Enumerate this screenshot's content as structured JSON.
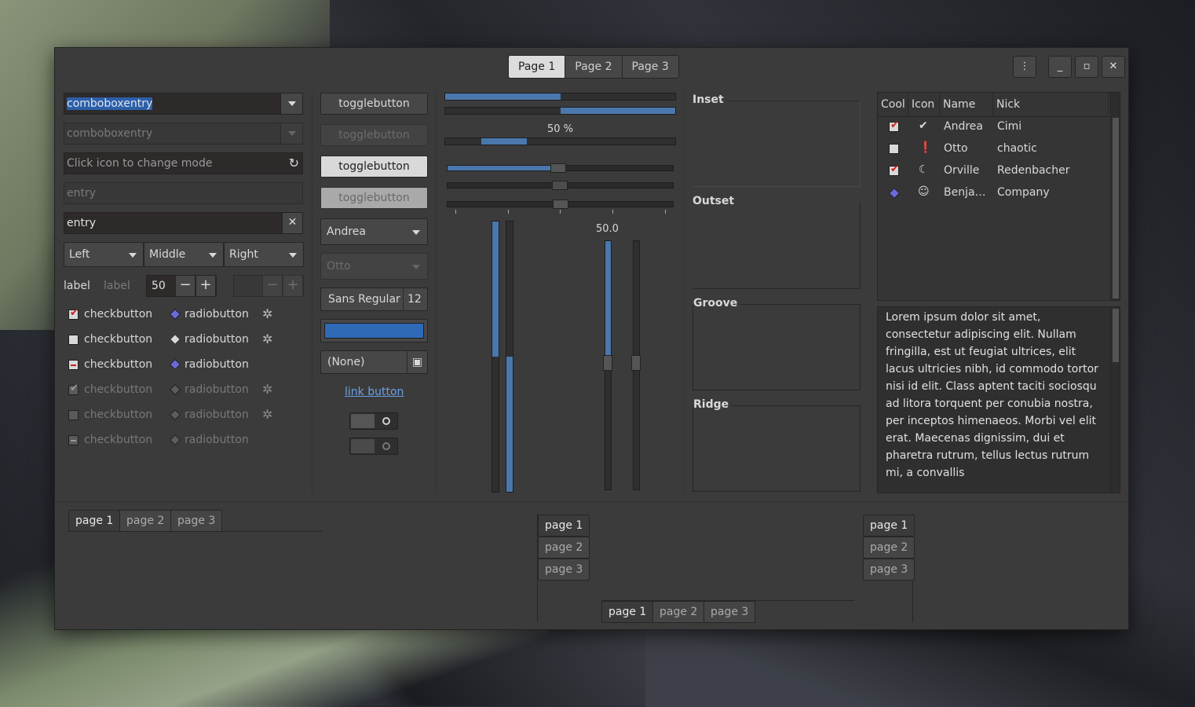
{
  "header": {
    "tabs": [
      "Page 1",
      "Page 2",
      "Page 3"
    ],
    "menu_icon": "vertical-dots-icon",
    "minimize_icon": "minimize-icon",
    "maximize_icon": "maximize-icon",
    "close_icon": "close-icon"
  },
  "entries": {
    "combo1": "comboboxentry",
    "combo2": "comboboxentry",
    "mode_placeholder": "Click icon to change mode",
    "entry_disabled": "entry",
    "entry_active": "entry"
  },
  "dropdowns": [
    "Left",
    "Middle",
    "Right"
  ],
  "labels": {
    "label1": "label",
    "label2": "label"
  },
  "spin": {
    "value": "50",
    "minus": "−",
    "plus": "+"
  },
  "checks": [
    {
      "label": "checkbutton",
      "state": "checked"
    },
    {
      "label": "checkbutton",
      "state": "unchecked"
    },
    {
      "label": "checkbutton",
      "state": "mixed"
    },
    {
      "label": "checkbutton",
      "state": "checked"
    },
    {
      "label": "checkbutton",
      "state": "unchecked"
    },
    {
      "label": "checkbutton",
      "state": "mixed"
    }
  ],
  "radios": [
    "radiobutton",
    "radiobutton",
    "radiobutton",
    "radiobutton",
    "radiobutton",
    "radiobutton"
  ],
  "toggles": [
    "togglebutton",
    "togglebutton",
    "togglebutton",
    "togglebutton"
  ],
  "combos": {
    "c1": "Andrea",
    "c2": "Otto"
  },
  "font": {
    "name": "Sans Regular",
    "size": "12"
  },
  "color": "#2f6ab7",
  "file": "(None)",
  "link": "link button",
  "progress": {
    "label": "50 %",
    "value": 0.5
  },
  "scale_value": "50.0",
  "frames": [
    "Inset",
    "Outset",
    "Groove",
    "Ridge"
  ],
  "tree": {
    "headers": [
      "Cool",
      "Icon",
      "Name",
      "Nick"
    ],
    "rows": [
      {
        "name": "Andrea",
        "nick": "Cimi",
        "icon": "check-circle-icon"
      },
      {
        "name": "Otto",
        "nick": "chaotic",
        "icon": "warning-icon"
      },
      {
        "name": "Orville",
        "nick": "Redenbacher",
        "icon": "moon-icon"
      },
      {
        "name": "Benja…",
        "nick": "Company",
        "icon": "people-icon"
      }
    ]
  },
  "text": "Lorem ipsum dolor sit amet, consectetur adipiscing elit. Nullam fringilla, est ut feugiat ultrices, elit lacus ultricies nibh, id commodo tortor nisi id elit. Class aptent taciti sociosqu ad litora torquent per conubia nostra, per inceptos himenaeos. Morbi vel elit erat. Maecenas dignissim, dui et pharetra rutrum, tellus lectus rutrum mi, a convallis",
  "notebook": [
    "page 1",
    "page 2",
    "page 3"
  ],
  "colors": {
    "accent": "#4a78ad",
    "selection": "#2c5fa8",
    "link": "#6aa0e6"
  }
}
